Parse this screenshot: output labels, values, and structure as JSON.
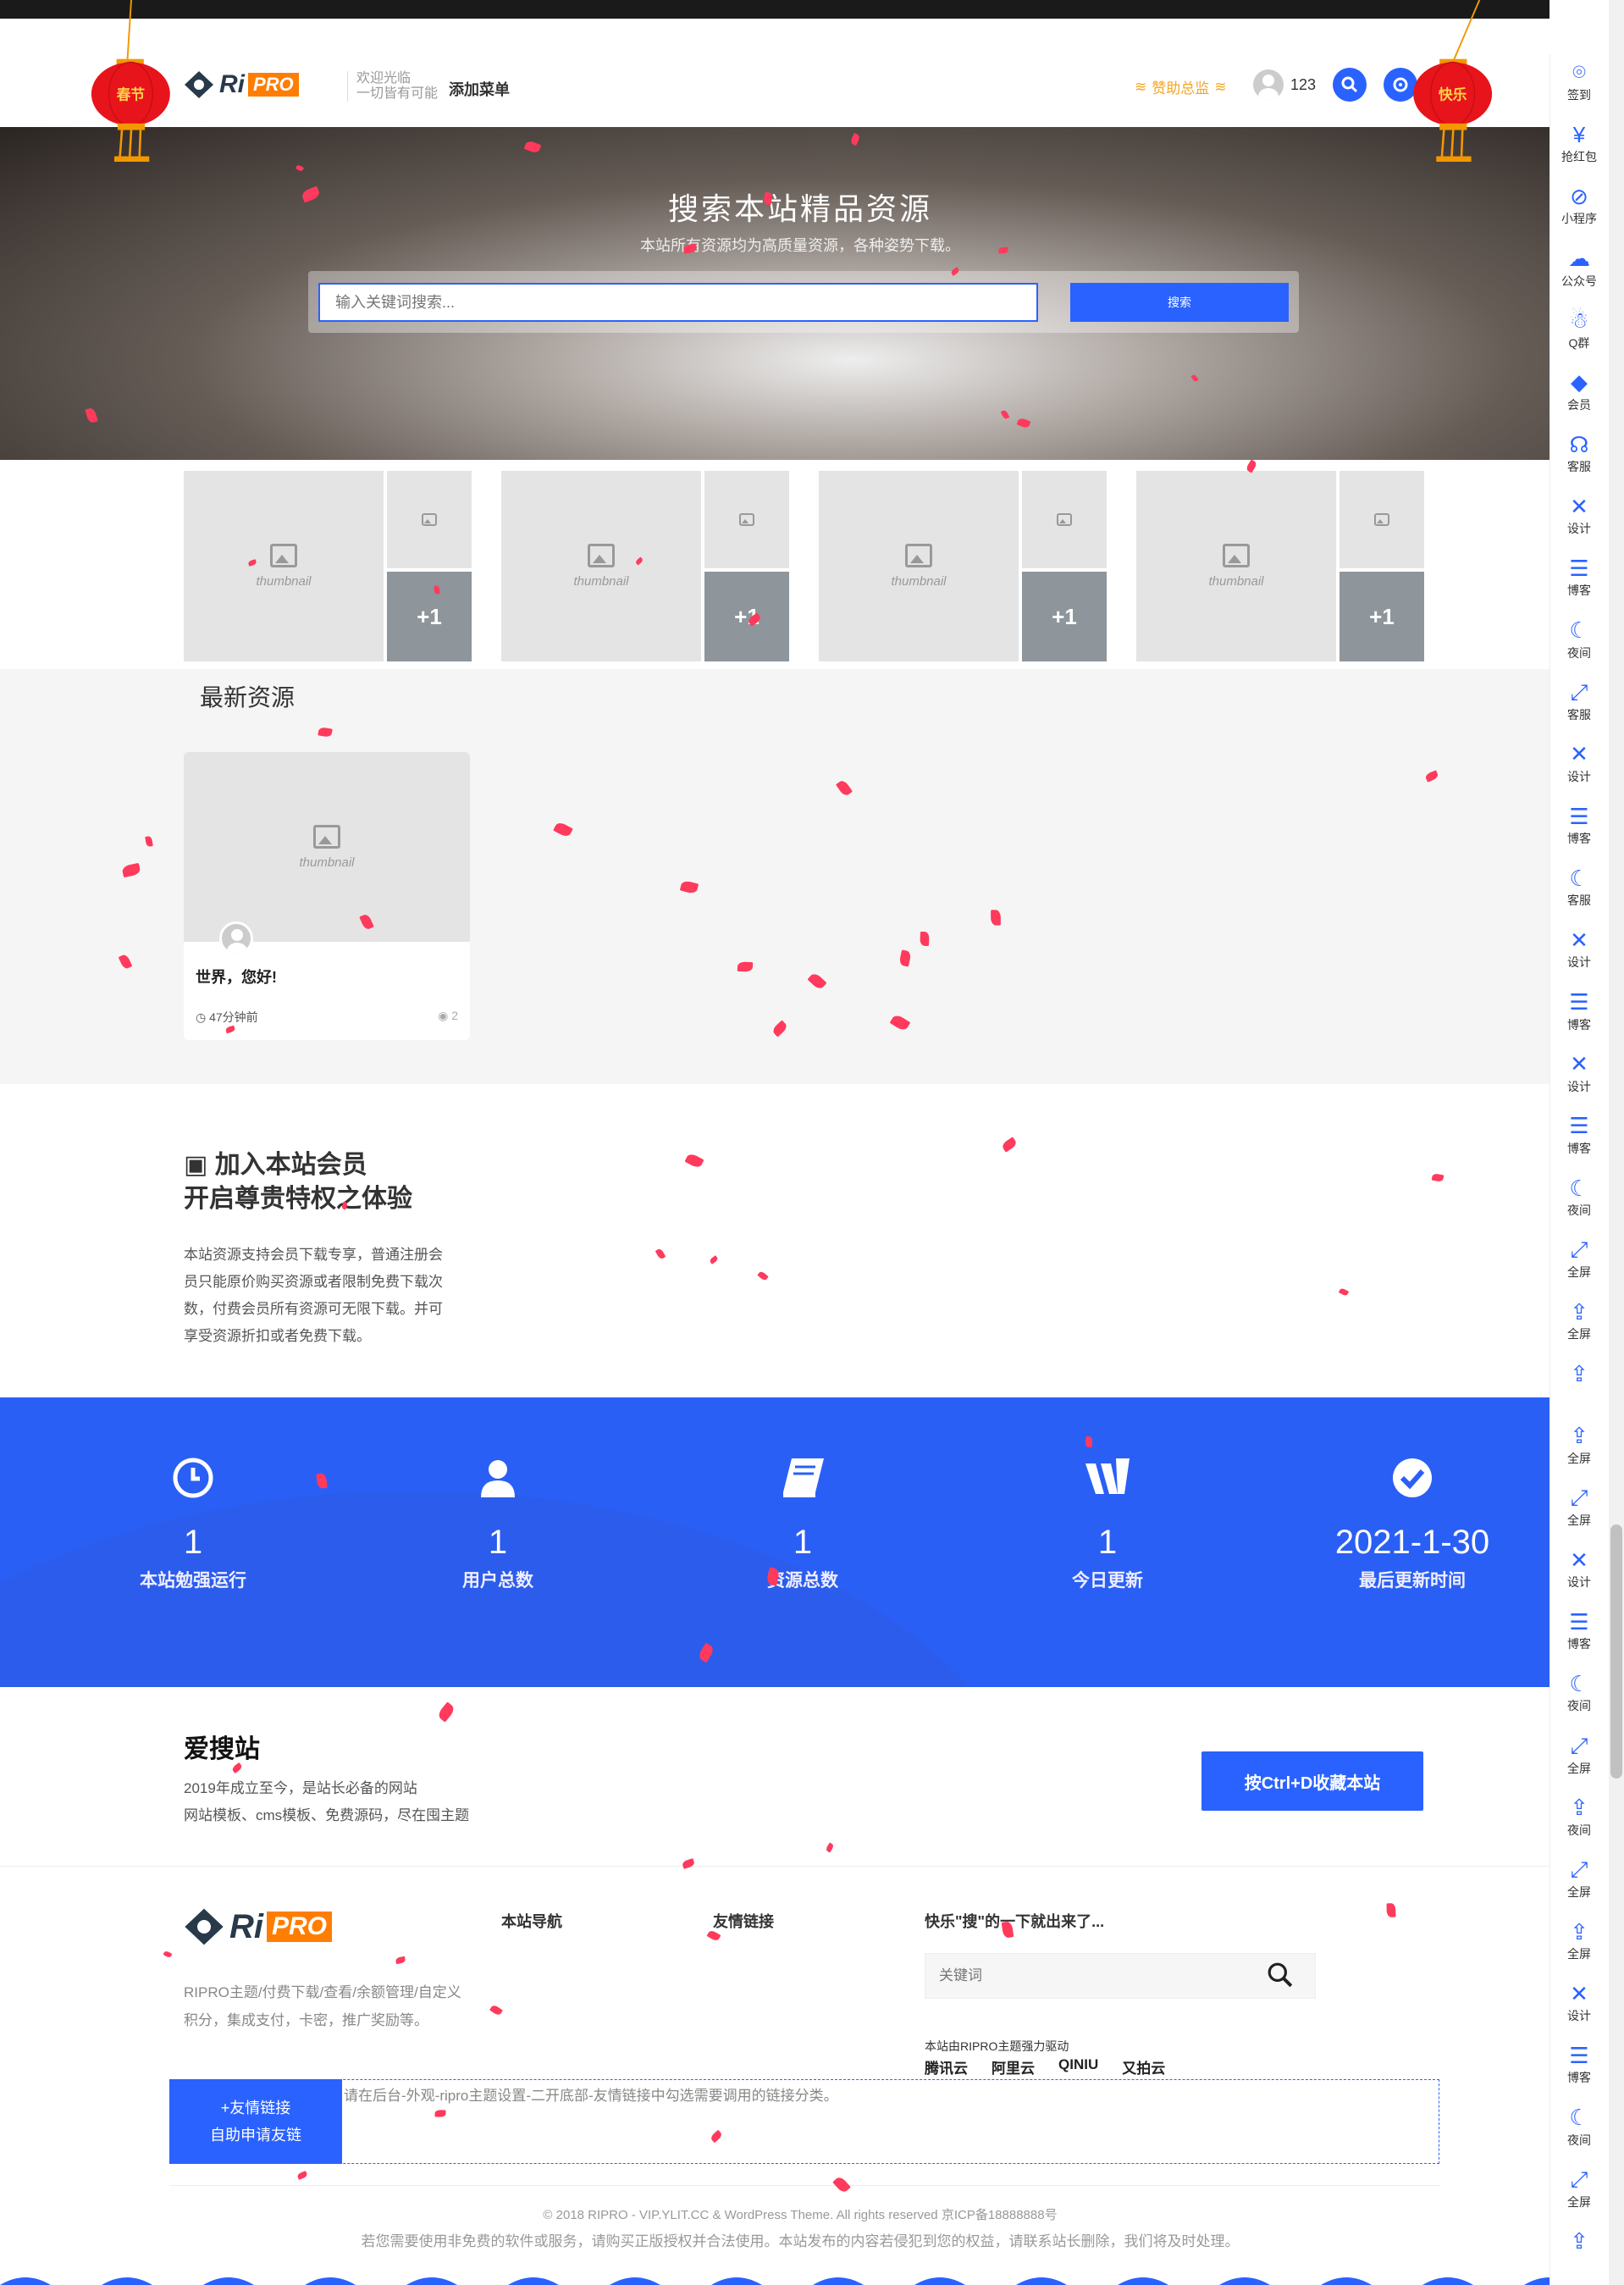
{
  "header": {
    "logo_ri": "Ri",
    "logo_pro": "PRO",
    "welcome_line1": "欢迎光临",
    "welcome_line2": "一切皆有可能",
    "add_menu": "添加菜单",
    "sponsor": "赞助总监",
    "username": "123"
  },
  "hero": {
    "title": "搜索本站精品资源",
    "subtitle": "本站所有资源均为高质量资源，各种姿势下载。",
    "search_placeholder": "输入关键词搜索...",
    "search_button": "搜索",
    "lantern_left": "春节",
    "lantern_right": "快乐"
  },
  "featured_cards": [
    {
      "thumb": "thumbnail",
      "small": "thumbnail",
      "plus": "+1"
    },
    {
      "thumb": "thumbnail",
      "small": "thumbnail",
      "plus": "+1"
    },
    {
      "thumb": "thumbnail",
      "small": "thumbnail",
      "plus": "+1"
    },
    {
      "thumb": "thumbnail",
      "small": "thumbnail",
      "plus": "+1"
    }
  ],
  "latest": {
    "title": "最新资源",
    "post": {
      "thumb": "thumbnail",
      "title": "世界，您好!",
      "time": "47分钟前",
      "views": "2"
    }
  },
  "vip": {
    "line1": "加入本站会员",
    "line2": "开启尊贵特权之体验",
    "text": "本站资源支持会员下载专享，普通注册会员只能原价购买资源或者限制免费下载次数，付费会员所有资源可无限下载。并可享受资源折扣或者免费下载。"
  },
  "stats": [
    {
      "icon": "clock-icon",
      "value": "1",
      "label": "本站勉强运行"
    },
    {
      "icon": "user-icon",
      "value": "1",
      "label": "用户总数"
    },
    {
      "icon": "book-icon",
      "value": "1",
      "label": "资源总数"
    },
    {
      "icon": "update-icon",
      "value": "1",
      "label": "今日更新"
    },
    {
      "icon": "check-icon",
      "value": "2021-1-30",
      "label": "最后更新时间"
    }
  ],
  "site": {
    "name": "爱搜站",
    "desc1": "2019年成立至今，是站长必备的网站",
    "desc2": "网站模板、cms模板、免费源码，尽在囤主题",
    "bookmark": "按Ctrl+D收藏本站"
  },
  "footer": {
    "logo_ri": "Ri",
    "logo_pro": "PRO",
    "desc": "RIPRO主题/付费下载/查看/余额管理/自定义积分，集成支付，卡密，推广奖励等。",
    "nav_title": "本站导航",
    "links_title": "友情链接",
    "search_title": "快乐\"搜\"的一下就出来了...",
    "search_placeholder": "关键词",
    "powered": "本站由RIPRO主题强力驱动",
    "partners": [
      "腾讯云",
      "阿里云",
      "QINIU",
      "又拍云"
    ],
    "friend_btn1": "+友情链接",
    "friend_btn2": "自助申请友链",
    "friend_text": "请在后台-外观-ripro主题设置-二开底部-友情链接中勾选需要调用的链接分类。",
    "copyright": "© 2018 RIPRO - VIP.YLIT.CC & WordPress Theme. All rights reserved  京ICP备18888888号",
    "disclaimer": "若您需要使用非免费的软件或服务，请购买正版授权并合法使用。本站发布的内容若侵犯到您的权益，请联系站长删除，我们将及时处理。"
  },
  "sidebar": [
    {
      "icon": "location-icon",
      "label": "签到"
    },
    {
      "icon": "red-packet-icon",
      "label": "抢红包"
    },
    {
      "icon": "mini-program-icon",
      "label": "小程序"
    },
    {
      "icon": "wechat-icon",
      "label": "公众号"
    },
    {
      "icon": "qq-icon",
      "label": "Q群"
    },
    {
      "icon": "diamond-icon",
      "label": "会员"
    },
    {
      "icon": "headset-icon",
      "label": "客服"
    },
    {
      "icon": "design-icon",
      "label": "设计"
    },
    {
      "icon": "blog-icon",
      "label": "博客"
    },
    {
      "icon": "moon-icon",
      "label": "夜间"
    },
    {
      "icon": "fullscreen-icon",
      "label": "客服"
    },
    {
      "icon": "design-icon",
      "label": "设计"
    },
    {
      "icon": "blog-icon",
      "label": "博客"
    },
    {
      "icon": "moon-icon",
      "label": "客服"
    },
    {
      "icon": "design-icon",
      "label": "设计"
    },
    {
      "icon": "blog-icon",
      "label": "博客"
    },
    {
      "icon": "design-icon",
      "label": "设计"
    },
    {
      "icon": "blog-icon",
      "label": "博客"
    },
    {
      "icon": "moon-icon",
      "label": "夜间"
    },
    {
      "icon": "fullscreen-icon",
      "label": "全屏"
    },
    {
      "icon": "rocket-icon",
      "label": "全屏"
    },
    {
      "icon": "rocket-icon",
      "label": ""
    },
    {
      "icon": "rocket-icon",
      "label": "全屏"
    },
    {
      "icon": "fullscreen-icon",
      "label": "全屏"
    },
    {
      "icon": "design-icon",
      "label": "设计"
    },
    {
      "icon": "blog-icon",
      "label": "博客"
    },
    {
      "icon": "moon-icon",
      "label": "夜间"
    },
    {
      "icon": "fullscreen-icon",
      "label": "全屏"
    },
    {
      "icon": "rocket-icon",
      "label": "夜间"
    },
    {
      "icon": "fullscreen-icon",
      "label": "全屏"
    },
    {
      "icon": "rocket-icon",
      "label": "全屏"
    },
    {
      "icon": "design-icon",
      "label": "设计"
    },
    {
      "icon": "blog-icon",
      "label": "博客"
    },
    {
      "icon": "moon-icon",
      "label": "夜间"
    },
    {
      "icon": "fullscreen-icon",
      "label": "全屏"
    },
    {
      "icon": "rocket-icon",
      "label": ""
    }
  ],
  "colors": {
    "accent": "#2a62ff",
    "orange": "#ff7d00",
    "lantern": "#e8141b"
  }
}
